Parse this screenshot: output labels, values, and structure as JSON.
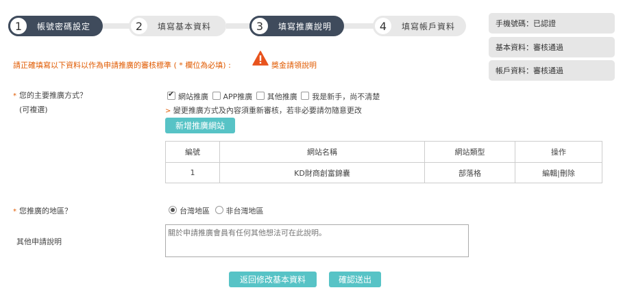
{
  "steps": [
    {
      "num": "1",
      "label": "帳號密碼設定",
      "active": true
    },
    {
      "num": "2",
      "label": "填寫基本資料",
      "active": false
    },
    {
      "num": "3",
      "label": "填寫推廣說明",
      "active": true
    },
    {
      "num": "4",
      "label": "填寫帳戶資料",
      "active": false
    }
  ],
  "status": [
    "手機號碼：已認證",
    "基本資料：審核通過",
    "帳戶資料：審核通過"
  ],
  "notice": {
    "text": "請正確填寫以下資料以作為申請推廣的審核標準 ( * 欄位為必填) :",
    "link": "獎金請領說明",
    "icon": "warning-icon"
  },
  "promo": {
    "star": "*",
    "label": "您的主要推廣方式？",
    "sublabel": "(可複選)",
    "options": [
      {
        "label": "網站推廣",
        "checked": true
      },
      {
        "label": "APP推廣",
        "checked": false
      },
      {
        "label": "其他推廣",
        "checked": false
      },
      {
        "label": "我是新手，尚不清楚",
        "checked": false
      }
    ],
    "hint_mark": ">",
    "hint": "變更推廣方式及內容須重新審核，若非必要請勿隨意更改",
    "add_button": "新增推廣網站"
  },
  "table": {
    "headers": [
      "編號",
      "網站名稱",
      "網站類型",
      "操作"
    ],
    "rows": [
      {
        "no": "1",
        "name": "KD財商創富錦囊",
        "type": "部落格",
        "edit": "編輯",
        "sep": "|",
        "del": "刪除"
      }
    ]
  },
  "region": {
    "star": "*",
    "label": "您推廣的地區？",
    "options": [
      {
        "label": "台灣地區",
        "checked": true
      },
      {
        "label": "非台灣地區",
        "checked": false
      }
    ]
  },
  "other": {
    "label": "其他申請說明",
    "placeholder": "關於申請推廣會員有任何其他想法可在此說明。"
  },
  "buttons": {
    "back": "返回修改基本資料",
    "submit": "確認送出"
  },
  "colors": {
    "accent": "#57c3c6",
    "active_step": "#3f4b5c",
    "notice": "#e05a00"
  }
}
